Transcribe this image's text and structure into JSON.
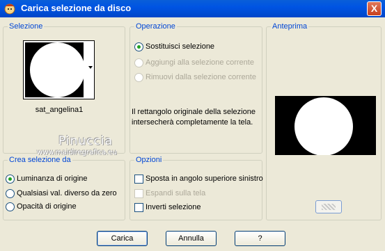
{
  "window": {
    "title": "Carica selezione da disco",
    "close_glyph": "X",
    "app_icon": "app-character-icon"
  },
  "selezione": {
    "legend": "Selezione",
    "selected_name": "sat_angelina1"
  },
  "operazione": {
    "legend": "Operazione",
    "options": [
      {
        "label": "Sostituisci selezione",
        "selected": true,
        "enabled": true
      },
      {
        "label": "Aggiungi alla selezione corrente",
        "selected": false,
        "enabled": false
      },
      {
        "label": "Rimuovi dalla selezione corrente",
        "selected": false,
        "enabled": false
      }
    ],
    "info_text": "Il rettangolo originale della selezione intersecherà completamente la tela."
  },
  "anteprima": {
    "legend": "Anteprima"
  },
  "crea": {
    "legend": "Crea selezione da",
    "options": [
      {
        "label": "Luminanza di origine",
        "selected": true
      },
      {
        "label": "Qualsiasi val. diverso da zero",
        "selected": false
      },
      {
        "label": "Opacità di origine",
        "selected": false
      }
    ]
  },
  "opzioni": {
    "legend": "Opzioni",
    "checks": [
      {
        "label": "Sposta in angolo superiore sinistro",
        "checked": false,
        "enabled": true
      },
      {
        "label": "Espandi sulla tela",
        "checked": false,
        "enabled": false
      },
      {
        "label": "Inverti selezione",
        "checked": false,
        "enabled": true
      }
    ]
  },
  "watermark": {
    "name": "Pinuccia",
    "site": "www.maidiregrafica.eu"
  },
  "buttons": {
    "load": "Carica",
    "cancel": "Annulla",
    "help": "?"
  },
  "colors": {
    "titlebar": "#0054e3",
    "legend_text": "#0046d5",
    "radio_dot": "#21a121"
  }
}
